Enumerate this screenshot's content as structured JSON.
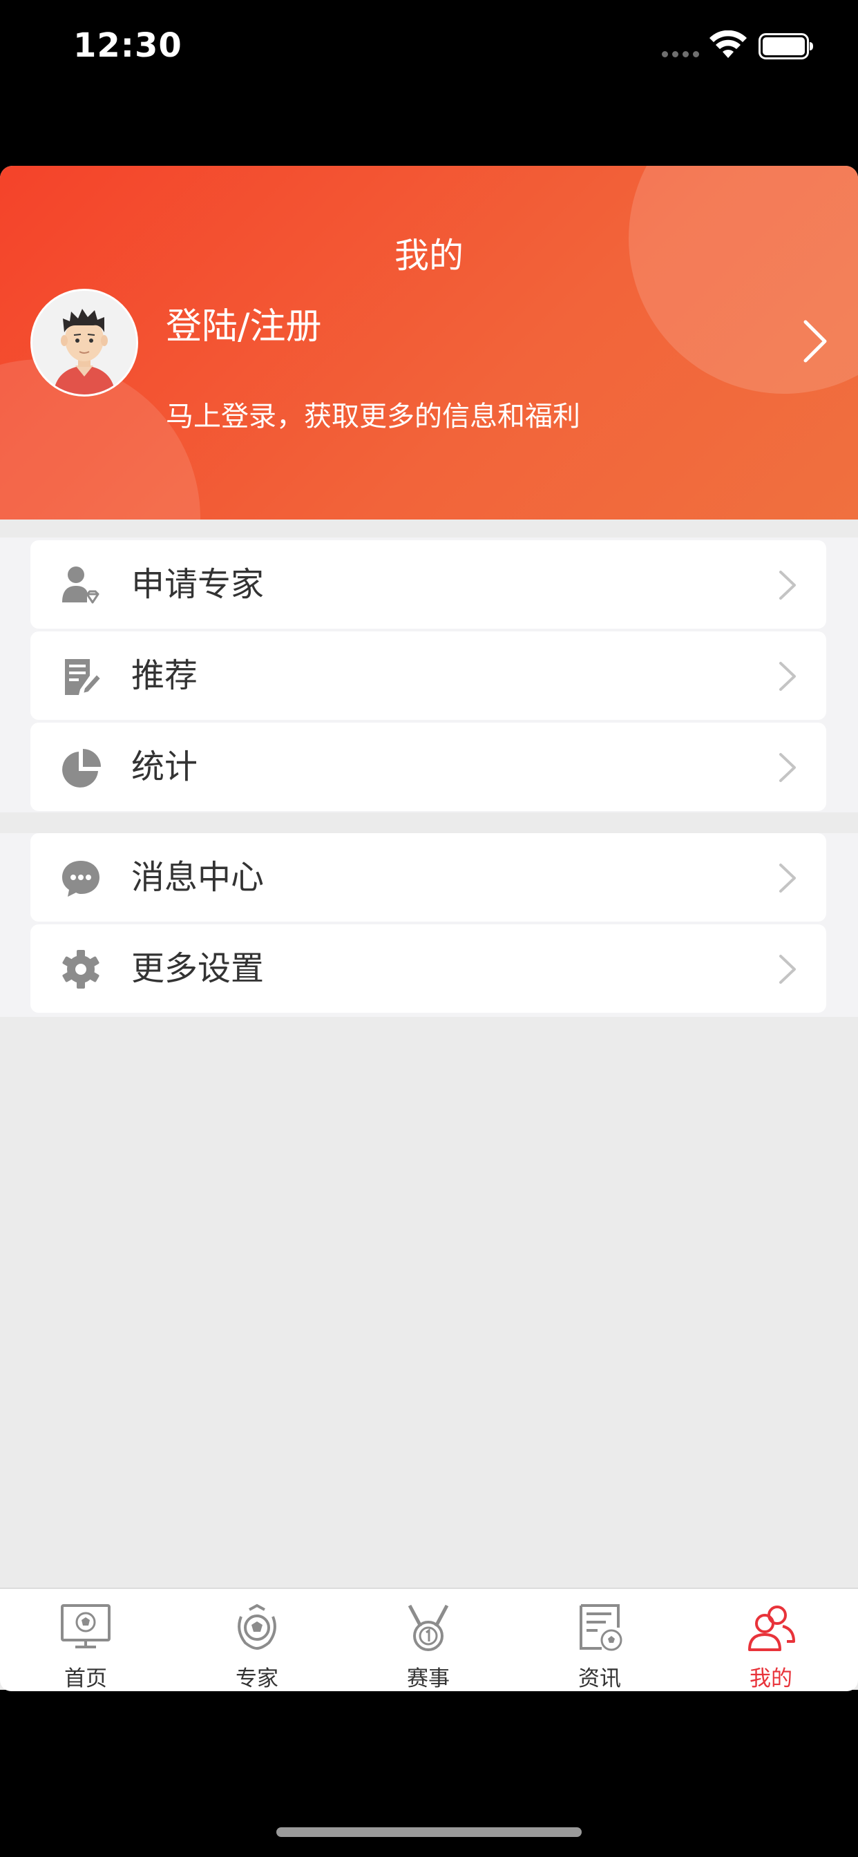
{
  "status_bar": {
    "time": "12:30"
  },
  "header": {
    "title": "我的",
    "login_title": "登陆/注册",
    "login_subtitle": "马上登录，获取更多的信息和福利"
  },
  "menu_group_1": [
    {
      "label": "申请专家",
      "icon": "expert-apply-icon"
    },
    {
      "label": "推荐",
      "icon": "edit-document-icon"
    },
    {
      "label": "统计",
      "icon": "pie-chart-icon"
    }
  ],
  "menu_group_2": [
    {
      "label": "消息中心",
      "icon": "chat-bubble-icon"
    },
    {
      "label": "更多设置",
      "icon": "gear-icon"
    }
  ],
  "tabbar": [
    {
      "label": "首页",
      "icon": "tv-soccer-icon",
      "active": false
    },
    {
      "label": "专家",
      "icon": "laurel-soccer-icon",
      "active": false
    },
    {
      "label": "赛事",
      "icon": "medal-icon",
      "active": false
    },
    {
      "label": "资讯",
      "icon": "news-soccer-icon",
      "active": false
    },
    {
      "label": "我的",
      "icon": "users-icon",
      "active": true
    }
  ],
  "colors": {
    "header_gradient_start": "#f4432a",
    "header_gradient_end": "#f0703f",
    "active_tab": "#e8333a",
    "inactive_icon": "#8c8c8c"
  }
}
